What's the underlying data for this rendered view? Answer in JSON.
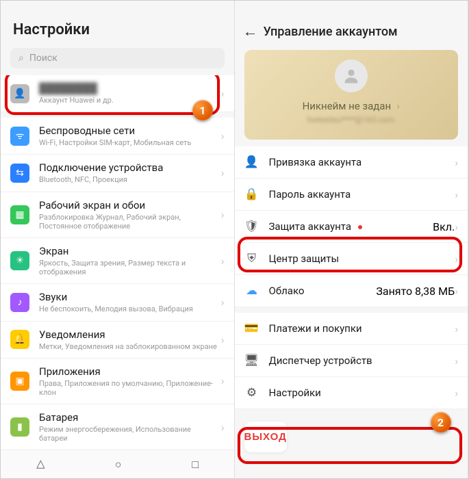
{
  "left": {
    "title": "Настройки",
    "search_placeholder": "Поиск",
    "account": {
      "name": "████████",
      "sub": "Аккаунт Huawei и др."
    },
    "items": [
      {
        "title": "Беспроводные сети",
        "sub": "Wi-Fi, Настройки SIM-карт, Мобильная сеть"
      },
      {
        "title": "Подключение устройства",
        "sub": "Bluetooth, NFC, Проекция"
      },
      {
        "title": "Рабочий экран и обои",
        "sub": "Разблокировка Журнал, Рабочий экран, Постоянное отображение"
      },
      {
        "title": "Экран",
        "sub": "Яркость, Защита зрения, Размер текста и отображения"
      },
      {
        "title": "Звуки",
        "sub": "Не беспокоить, Мелодия вызова, Вибрация"
      },
      {
        "title": "Уведомления",
        "sub": "Метки, Уведомления на заблокированном экране"
      },
      {
        "title": "Приложения",
        "sub": "Права, Приложения по умолчанию, Приложение-клон"
      },
      {
        "title": "Батарея",
        "sub": "Режим энергосбережения, Использование батареи"
      }
    ],
    "callout": "1"
  },
  "right": {
    "title": "Управление аккаунтом",
    "nickname": "Никнейм не задан",
    "email": "hwtesteu****@163.com",
    "items": [
      {
        "title": "Привязка аккаунта",
        "rval": ""
      },
      {
        "title": "Пароль аккаунта",
        "rval": ""
      },
      {
        "title": "Защита аккаунта",
        "rval": "Вкл.",
        "dot": true
      },
      {
        "title": "Центр защиты",
        "rval": "",
        "highlight": true
      },
      {
        "title": "Облако",
        "rval": "Занято 8,38 МБ",
        "cloud": true
      },
      {
        "title": "Платежи и покупки",
        "rval": ""
      },
      {
        "title": "Диспетчер устройств",
        "rval": ""
      },
      {
        "title": "Настройки",
        "rval": ""
      }
    ],
    "logout": "ВЫХОД",
    "callout": "2"
  }
}
